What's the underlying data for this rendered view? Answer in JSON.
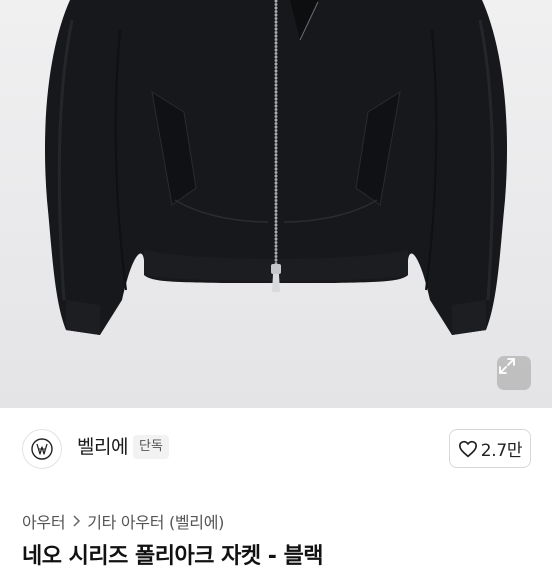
{
  "product": {
    "image_alt": "Black bomber jacket with two-way zipper",
    "expand_icon": "expand-icon"
  },
  "seller": {
    "name": "벨리에",
    "badge": "단독",
    "avatar_icon": "brand-logo-icon"
  },
  "like": {
    "count": "2.7만",
    "icon": "heart-icon"
  },
  "breadcrumb": {
    "items": [
      "아우터",
      "기타 아우터 (벨리에)"
    ],
    "separator_icon": "chevron-right-icon"
  },
  "title": {
    "text": "네오 시리즈 폴리아크 자켓 - 블랙"
  }
}
